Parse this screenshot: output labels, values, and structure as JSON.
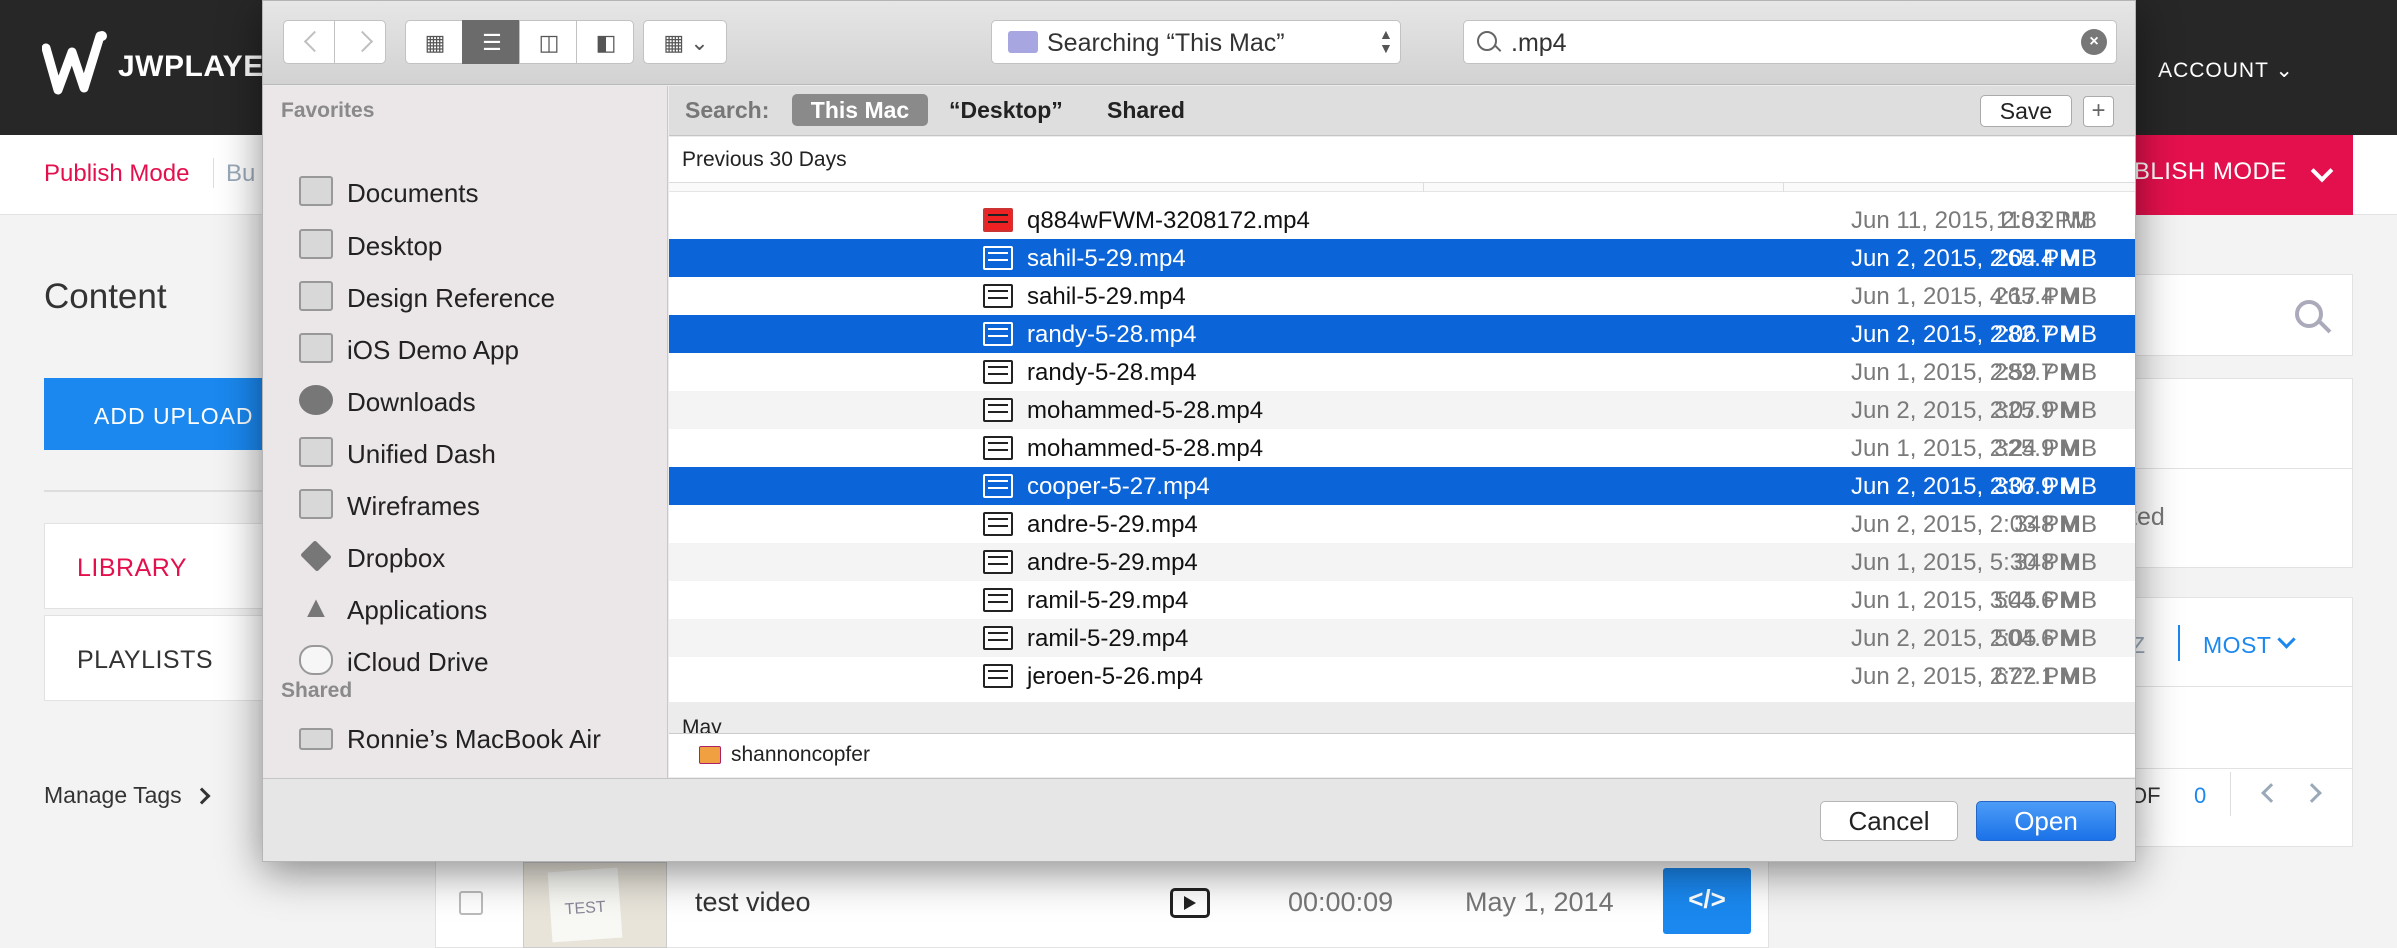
{
  "app": {
    "logo_text": "JWPLAYER",
    "account_label": "ACCOUNT",
    "publish_mode_link": "Publish Mode",
    "bu_text": "Bu",
    "publish_mode_button": "UBLISH MODE",
    "content_title": "Content",
    "add_upload_label": "ADD UPLOAD",
    "library_label": "LIBRARY",
    "playlists_label": "PLAYLISTS",
    "manage_tags_label": "Manage Tags",
    "video_row": {
      "title": "test video",
      "duration": "00:00:09",
      "date": "May 1, 2014",
      "thumb_text": "TEST",
      "embed_label": "</>"
    },
    "right_panel": {
      "partial_text": "ted",
      "sort_partial": "Z",
      "sort_label": "MOST",
      "pager_of": "OF",
      "pager_total": "0"
    },
    "colors": {
      "brand_red": "#e4104d",
      "accent_blue": "#1a88ef",
      "topbar": "#272727"
    }
  },
  "dialog": {
    "search_scope_label": "Searching “This Mac”",
    "search_query": ".mp4",
    "clear_icon": "close-icon",
    "sidebar": {
      "favorites_heading": "Favorites",
      "favorites": [
        {
          "label": "Documents",
          "icon": "documents-icon"
        },
        {
          "label": "Desktop",
          "icon": "desktop-icon"
        },
        {
          "label": "Design Reference",
          "icon": "folder-icon"
        },
        {
          "label": "iOS Demo App",
          "icon": "folder-icon"
        },
        {
          "label": "Downloads",
          "icon": "downloads-icon"
        },
        {
          "label": "Unified Dash",
          "icon": "folder-icon"
        },
        {
          "label": "Wireframes",
          "icon": "folder-icon"
        },
        {
          "label": "Dropbox",
          "icon": "dropbox-icon"
        },
        {
          "label": "Applications",
          "icon": "applications-icon"
        },
        {
          "label": "iCloud Drive",
          "icon": "cloud-icon"
        }
      ],
      "shared_heading": "Shared",
      "shared": [
        {
          "label": "Ronnie’s MacBook Air",
          "icon": "laptop-icon"
        }
      ]
    },
    "scope_bar": {
      "label": "Search:",
      "this_mac": "This Mac",
      "desktop": "“Desktop”",
      "shared": "Shared",
      "save": "Save",
      "add": "+"
    },
    "section_label": "Previous 30 Days",
    "next_section_label": "May",
    "files": [
      {
        "name": "q884wFWM-3208172.mp4",
        "date": "Jun 11, 2015, 2:03 PM",
        "size": "118.2 MB",
        "selected": false
      },
      {
        "name": "sahil-5-29.mp4",
        "date": "Jun 2, 2015, 2:04 PM",
        "size": "265.4 MB",
        "selected": true
      },
      {
        "name": "sahil-5-29.mp4",
        "date": "Jun 1, 2015, 4:17 PM",
        "size": "265.4 MB",
        "selected": false
      },
      {
        "name": "randy-5-28.mp4",
        "date": "Jun 2, 2015, 2:06 PM",
        "size": "282.7 MB",
        "selected": true
      },
      {
        "name": "randy-5-28.mp4",
        "date": "Jun 1, 2015, 2:59 PM",
        "size": "282.7 MB",
        "selected": false
      },
      {
        "name": "mohammed-5-28.mp4",
        "date": "Jun 2, 2015, 2:07 PM",
        "size": "325.9 MB",
        "selected": false
      },
      {
        "name": "mohammed-5-28.mp4",
        "date": "Jun 1, 2015, 2:24 PM",
        "size": "325.9 MB",
        "selected": false
      },
      {
        "name": "cooper-5-27.mp4",
        "date": "Jun 2, 2015, 2:07 PM",
        "size": "336.9 MB",
        "selected": true
      },
      {
        "name": "andre-5-29.mp4",
        "date": "Jun 2, 2015, 2:03 PM",
        "size": "348 MB",
        "selected": false
      },
      {
        "name": "andre-5-29.mp4",
        "date": "Jun 1, 2015, 5:30 PM",
        "size": "348 MB",
        "selected": false
      },
      {
        "name": "ramil-5-29.mp4",
        "date": "Jun 1, 2015, 3:45 PM",
        "size": "504.6 MB",
        "selected": false
      },
      {
        "name": "ramil-5-29.mp4",
        "date": "Jun 2, 2015, 2:05 PM",
        "size": "504.6 MB",
        "selected": false
      },
      {
        "name": "jeroen-5-26.mp4",
        "date": "Jun 2, 2015, 2:22 PM",
        "size": "677.1 MB",
        "selected": false
      }
    ],
    "path_label": "shannoncopfer",
    "cancel_label": "Cancel",
    "open_label": "Open",
    "colors": {
      "selection": "#0b64d8",
      "open_button": "#1b72e8"
    }
  }
}
